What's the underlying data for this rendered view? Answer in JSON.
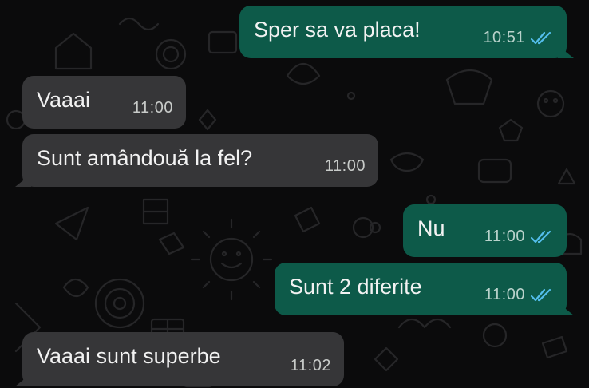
{
  "conversation": {
    "messages": [
      {
        "direction": "outgoing",
        "text": "Sper sa va placa!",
        "time": "10:51",
        "status_icon": "double-check-read-icon"
      },
      {
        "direction": "incoming",
        "text": "Vaaai",
        "time": "11:00"
      },
      {
        "direction": "incoming",
        "text": "Sunt amândouă la fel?",
        "time": "11:00"
      },
      {
        "direction": "outgoing",
        "text": "Nu",
        "time": "11:00",
        "status_icon": "double-check-read-icon"
      },
      {
        "direction": "outgoing",
        "text": "Sunt 2 diferite",
        "time": "11:00",
        "status_icon": "double-check-read-icon"
      },
      {
        "direction": "incoming",
        "text": "Vaaai sunt superbe",
        "time": "11:02"
      }
    ]
  },
  "colors": {
    "background": "#0b0b0c",
    "incoming_bubble": "#363638",
    "outgoing_bubble": "#0d5a49",
    "read_check": "#53bdeb",
    "doodle_stroke": "#262628"
  }
}
